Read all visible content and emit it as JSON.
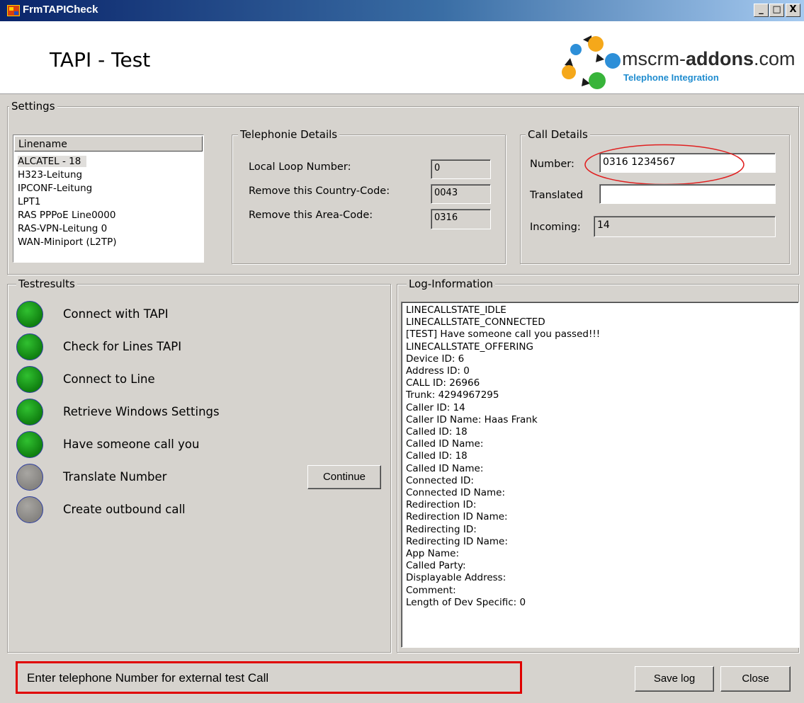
{
  "window": {
    "title": "FrmTAPICheck",
    "controls": {
      "minimize": "_",
      "maximize": "□",
      "close": "X"
    }
  },
  "header": {
    "heading": "TAPI - Test",
    "logo": {
      "brand_prefix": "mscrm-",
      "brand_bold": "addons",
      "brand_suffix": ".com",
      "tagline": "Telephone Integration"
    }
  },
  "settings": {
    "legend": "Settings",
    "lines": {
      "header": "Linename",
      "selected": "ALCATEL - 18",
      "items": [
        "ALCATEL - 18",
        "H323-Leitung",
        "IPCONF-Leitung",
        "LPT1",
        "RAS PPPoE Line0000",
        "RAS-VPN-Leitung 0",
        "WAN-Miniport (L2TP)"
      ]
    },
    "telephonie": {
      "legend": "Telephonie Details",
      "local_loop_label": "Local Loop Number:",
      "local_loop_value": "0",
      "country_code_label": "Remove this Country-Code:",
      "country_code_value": "0043",
      "area_code_label": "Remove this Area-Code:",
      "area_code_value": "0316"
    },
    "call": {
      "legend": "Call Details",
      "number_label": "Number:",
      "number_value": "0316 1234567",
      "translated_label": "Translated",
      "translated_value": "",
      "incoming_label": "Incoming:",
      "incoming_value": "14",
      "highlight_color": "#e02020"
    }
  },
  "testresults": {
    "legend": "Testresults",
    "items": [
      {
        "label": "Connect with TAPI",
        "status": "passed"
      },
      {
        "label": "Check for Lines TAPI",
        "status": "passed"
      },
      {
        "label": "Connect to Line",
        "status": "passed"
      },
      {
        "label": "Retrieve Windows Settings",
        "status": "passed"
      },
      {
        "label": "Have someone call you",
        "status": "passed"
      },
      {
        "label": "Translate Number",
        "status": "pending"
      },
      {
        "label": "Create outbound call",
        "status": "pending"
      }
    ],
    "continue_label": "Continue",
    "colors": {
      "passed": "#1a8f1a",
      "pending": "#95938f"
    }
  },
  "log": {
    "legend": "Log-Information",
    "lines": [
      "LINECALLSTATE_IDLE",
      "LINECALLSTATE_CONNECTED",
      "[TEST] Have someone call you passed!!!",
      "LINECALLSTATE_OFFERING",
      "Device ID: 6",
      "Address ID: 0",
      "CALL ID: 26966",
      "Trunk: 4294967295",
      "Caller ID: 14",
      "Caller ID Name: Haas Frank",
      "Called ID: 18",
      "Called ID Name:",
      "Called ID: 18",
      "Called ID Name:",
      "Connected ID:",
      "Connected ID Name:",
      "Redirection ID:",
      "Redirection ID Name:",
      "Redirecting ID:",
      "Redirecting ID Name:",
      "App Name:",
      "Called Party:",
      "Displayable Address:",
      "Comment:",
      "Length of Dev Specific: 0"
    ]
  },
  "footer": {
    "status_text": "Enter telephone Number for external test Call",
    "save_log_label": "Save log",
    "close_label": "Close",
    "status_border_color": "#e00000"
  }
}
